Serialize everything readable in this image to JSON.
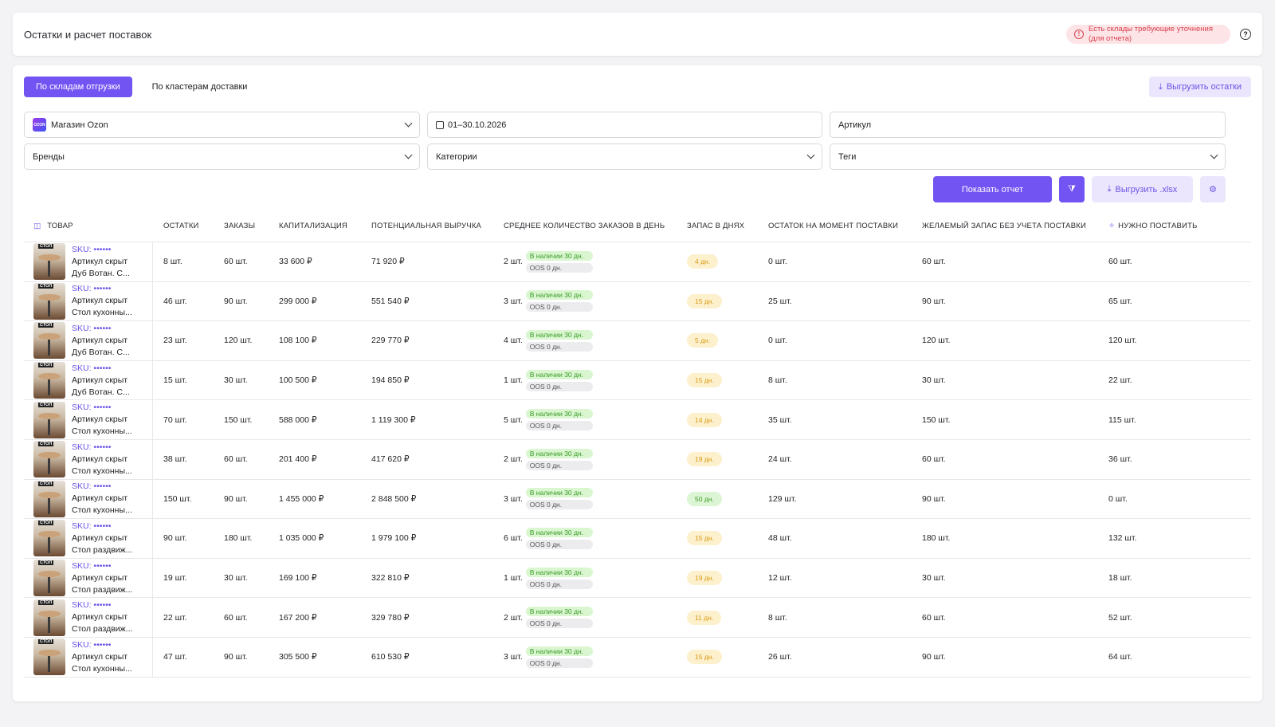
{
  "header": {
    "title": "Остатки и расчет поставок",
    "alert_line1": "Есть склады требующие уточнения",
    "alert_line2": "(для отчета)",
    "help_glyph": "?"
  },
  "tabs": [
    {
      "label": "По складам отгрузки",
      "active": true
    },
    {
      "label": "По кластерам доставки",
      "active": false
    }
  ],
  "export_stock_label": "Выгрузить остатки",
  "filters": {
    "store": "Магазин Ozon",
    "store_logo_text": "OZON",
    "dates": "01–30.10.2026",
    "article_placeholder": "Артикул",
    "brands": "Бренды",
    "categories": "Категории",
    "tags": "Теги"
  },
  "actions": {
    "show_report": "Показать отчет",
    "export_xlsx": "Выгрузить .xlsx"
  },
  "columns": [
    "ТОВАР",
    "ОСТАТКИ",
    "ЗАКАЗЫ",
    "КАПИТАЛИЗАЦИЯ",
    "ПОТЕНЦИАЛЬНАЯ ВЫРУЧКА",
    "СРЕДНЕЕ КОЛИЧЕСТВО ЗАКАЗОВ В ДЕНЬ",
    "ЗАПАС В ДНЯХ",
    "ОСТАТОК НА МОМЕНТ ПОСТАВКИ",
    "ЖЕЛАЕМЫЙ ЗАПАС БЕЗ УЧЕТА ПОСТАВКИ",
    "НУЖНО ПОСТАВИТЬ"
  ],
  "rows": [
    {
      "sku": "SKU: ••••••",
      "article": "Артикул скрыт",
      "name": "Дуб Вотан. С...",
      "thumb_tag": "СТОЛ",
      "stock": "8 шт.",
      "orders": "60 шт.",
      "cap": "33 600 ₽",
      "revenue": "71 920 ₽",
      "avg": "2 шт.",
      "in_stock": "В наличии 30 дн.",
      "oos": "OOS 0 дн.",
      "days": "4 дн.",
      "days_green": false,
      "at_delivery": "0 шт.",
      "desired": "60 шт.",
      "need": "60 шт."
    },
    {
      "sku": "SKU: ••••••",
      "article": "Артикул скрыт",
      "name": "Стол кухонны...",
      "thumb_tag": "СТОЛ",
      "stock": "46 шт.",
      "orders": "90 шт.",
      "cap": "299 000 ₽",
      "revenue": "551 540 ₽",
      "avg": "3 шт.",
      "in_stock": "В наличии 30 дн.",
      "oos": "OOS 0 дн.",
      "days": "15 дн.",
      "days_green": false,
      "at_delivery": "25 шт.",
      "desired": "90 шт.",
      "need": "65 шт."
    },
    {
      "sku": "SKU: ••••••",
      "article": "Артикул скрыт",
      "name": "Дуб Вотан. С...",
      "thumb_tag": "СТОЛ",
      "stock": "23 шт.",
      "orders": "120 шт.",
      "cap": "108 100 ₽",
      "revenue": "229 770 ₽",
      "avg": "4 шт.",
      "in_stock": "В наличии 30 дн.",
      "oos": "OOS 0 дн.",
      "days": "5 дн.",
      "days_green": false,
      "at_delivery": "0 шт.",
      "desired": "120 шт.",
      "need": "120 шт."
    },
    {
      "sku": "SKU: ••••••",
      "article": "Артикул скрыт",
      "name": "Дуб Вотан. С...",
      "thumb_tag": "СТОЛ",
      "stock": "15 шт.",
      "orders": "30 шт.",
      "cap": "100 500 ₽",
      "revenue": "194 850 ₽",
      "avg": "1 шт.",
      "in_stock": "В наличии 30 дн.",
      "oos": "OOS 0 дн.",
      "days": "15 дн.",
      "days_green": false,
      "at_delivery": "8 шт.",
      "desired": "30 шт.",
      "need": "22 шт."
    },
    {
      "sku": "SKU: ••••••",
      "article": "Артикул скрыт",
      "name": "Стол кухонны...",
      "thumb_tag": "СТОЛ",
      "stock": "70 шт.",
      "orders": "150 шт.",
      "cap": "588 000 ₽",
      "revenue": "1 119 300 ₽",
      "avg": "5 шт.",
      "in_stock": "В наличии 30 дн.",
      "oos": "OOS 0 дн.",
      "days": "14 дн.",
      "days_green": false,
      "at_delivery": "35 шт.",
      "desired": "150 шт.",
      "need": "115 шт."
    },
    {
      "sku": "SKU: ••••••",
      "article": "Артикул скрыт",
      "name": "Стол кухонны...",
      "thumb_tag": "СТОЛ",
      "stock": "38 шт.",
      "orders": "60 шт.",
      "cap": "201 400 ₽",
      "revenue": "417 620 ₽",
      "avg": "2 шт.",
      "in_stock": "В наличии 30 дн.",
      "oos": "OOS 0 дн.",
      "days": "19 дн.",
      "days_green": false,
      "at_delivery": "24 шт.",
      "desired": "60 шт.",
      "need": "36 шт."
    },
    {
      "sku": "SKU: ••••••",
      "article": "Артикул скрыт",
      "name": "Стол кухонны...",
      "thumb_tag": "СТОЛ",
      "stock": "150 шт.",
      "orders": "90 шт.",
      "cap": "1 455 000 ₽",
      "revenue": "2 848 500 ₽",
      "avg": "3 шт.",
      "in_stock": "В наличии 30 дн.",
      "oos": "OOS 0 дн.",
      "days": "50 дн.",
      "days_green": true,
      "at_delivery": "129 шт.",
      "desired": "90 шт.",
      "need": "0 шт."
    },
    {
      "sku": "SKU: ••••••",
      "article": "Артикул скрыт",
      "name": "Стол раздвиж...",
      "thumb_tag": "СТОЛ",
      "stock": "90 шт.",
      "orders": "180 шт.",
      "cap": "1 035 000 ₽",
      "revenue": "1 979 100 ₽",
      "avg": "6 шт.",
      "in_stock": "В наличии 30 дн.",
      "oos": "OOS 0 дн.",
      "days": "15 дн.",
      "days_green": false,
      "at_delivery": "48 шт.",
      "desired": "180 шт.",
      "need": "132 шт."
    },
    {
      "sku": "SKU: ••••••",
      "article": "Артикул скрыт",
      "name": "Стол раздвиж...",
      "thumb_tag": "СТОЛ",
      "stock": "19 шт.",
      "orders": "30 шт.",
      "cap": "169 100 ₽",
      "revenue": "322 810 ₽",
      "avg": "1 шт.",
      "in_stock": "В наличии 30 дн.",
      "oos": "OOS 0 дн.",
      "days": "19 дн.",
      "days_green": false,
      "at_delivery": "12 шт.",
      "desired": "30 шт.",
      "need": "18 шт."
    },
    {
      "sku": "SKU: ••••••",
      "article": "Артикул скрыт",
      "name": "Стол раздвиж...",
      "thumb_tag": "СТОЛ",
      "stock": "22 шт.",
      "orders": "60 шт.",
      "cap": "167 200 ₽",
      "revenue": "329 780 ₽",
      "avg": "2 шт.",
      "in_stock": "В наличии 30 дн.",
      "oos": "OOS 0 дн.",
      "days": "11 дн.",
      "days_green": false,
      "at_delivery": "8 шт.",
      "desired": "60 шт.",
      "need": "52 шт."
    },
    {
      "sku": "SKU: ••••••",
      "article": "Артикул скрыт",
      "name": "Стол кухонны...",
      "thumb_tag": "СТОЛ",
      "stock": "47 шт.",
      "orders": "90 шт.",
      "cap": "305 500 ₽",
      "revenue": "610 530 ₽",
      "avg": "3 шт.",
      "in_stock": "В наличии 30 дн.",
      "oos": "OOS 0 дн.",
      "days": "15 дн.",
      "days_green": false,
      "at_delivery": "26 шт.",
      "desired": "90 шт.",
      "need": "64 шт."
    }
  ],
  "colors": {
    "accent": "#7254f3",
    "alert": "#d9414f"
  }
}
